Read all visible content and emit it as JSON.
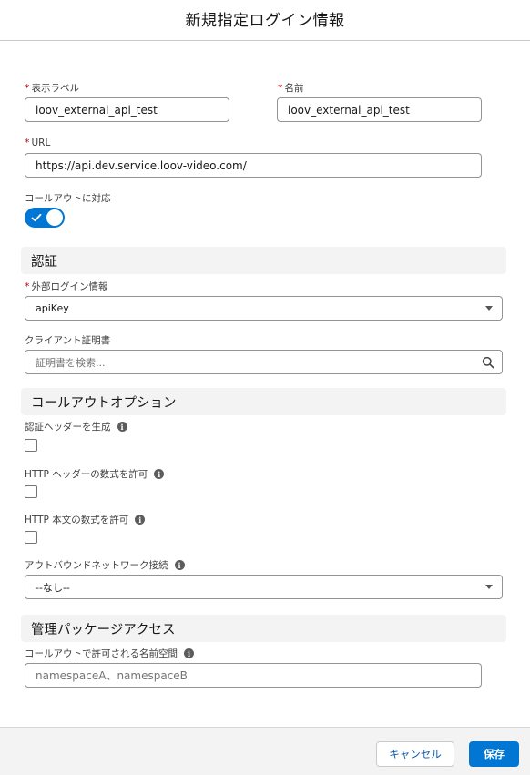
{
  "header": {
    "title": "新規指定ログイン情報"
  },
  "form": {
    "label_field": {
      "label": "表示ラベル",
      "value": "loov_external_api_test"
    },
    "name_field": {
      "label": "名前",
      "value": "loov_external_api_test"
    },
    "url_field": {
      "label": "URL",
      "value": "https://api.dev.service.loov-video.com/"
    },
    "callout_toggle": {
      "label": "コールアウトに対応",
      "checked": true
    },
    "required_marker": "*"
  },
  "auth_section": {
    "title": "認証",
    "external_credential": {
      "label": "外部ログイン情報",
      "value": "apiKey"
    },
    "client_cert": {
      "label": "クライアント証明書",
      "placeholder": "証明書を検索..."
    }
  },
  "callout_section": {
    "title": "コールアウトオプション",
    "generate_auth_header": {
      "label": "認証ヘッダーを生成",
      "checked": false
    },
    "allow_header_formulas": {
      "label": "HTTP ヘッダーの数式を許可",
      "checked": false
    },
    "allow_body_formulas": {
      "label": "HTTP 本文の数式を許可",
      "checked": false
    },
    "outbound_network": {
      "label": "アウトバウンドネットワーク接続",
      "value": "--なし--"
    }
  },
  "managed_section": {
    "title": "管理パッケージアクセス",
    "namespaces": {
      "label": "コールアウトで許可される名前空間",
      "placeholder": "namespaceA、namespaceB"
    }
  },
  "footer": {
    "cancel_label": "キャンセル",
    "save_label": "保存"
  },
  "icons": {
    "info": "i"
  },
  "colors": {
    "brand": "#0176d3",
    "required": "#ba0517",
    "section_bg": "#f3f3f3"
  }
}
